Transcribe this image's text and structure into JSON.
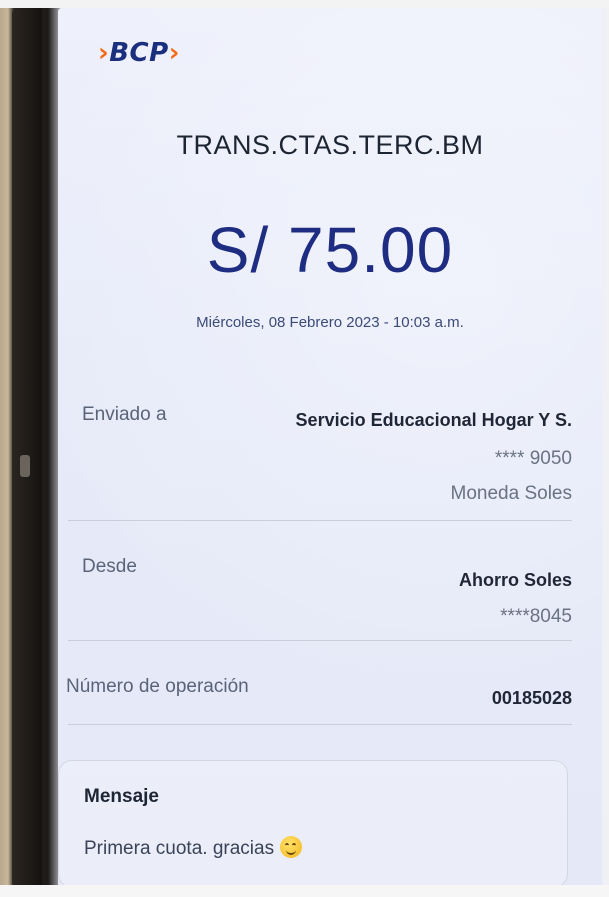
{
  "logo": {
    "chevron_left": "›",
    "text": "BCP",
    "chevron_right": "›"
  },
  "receipt": {
    "title": "TRANS.CTAS.TERC.BM",
    "amount": "S/ 75.00",
    "datetime": "Miércoles, 08 Febrero 2023 - 10:03 a.m."
  },
  "sent_to": {
    "label": "Enviado a",
    "name": "Servicio Educacional Hogar Y S.",
    "account": "**** 9050",
    "currency": "Moneda Soles"
  },
  "from": {
    "label": "Desde",
    "account_type": "Ahorro Soles",
    "account": "****8045"
  },
  "operation": {
    "label": "Número de operación",
    "number": "00185028"
  },
  "message": {
    "title": "Mensaje",
    "text": "Primera cuota. gracias",
    "emoji": "smiling-face"
  },
  "colors": {
    "brand_blue": "#1a2f7d",
    "brand_orange": "#f36b16",
    "amount_blue": "#1e2d82"
  }
}
